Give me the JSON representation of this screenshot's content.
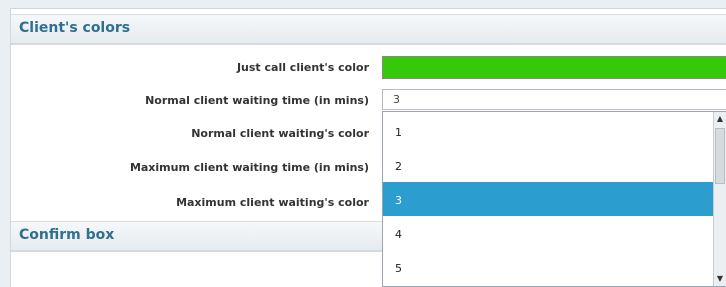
{
  "sections": {
    "clients_colors": {
      "title": "Client's colors"
    },
    "confirm_box": {
      "title": "Confirm box"
    }
  },
  "fields": {
    "just_call_color": {
      "label": "Just call client's color",
      "color": "#36c909"
    },
    "normal_wait_time": {
      "label": "Normal client waiting time (in mins)",
      "value": "3"
    },
    "normal_wait_color": {
      "label": "Normal client waiting's color"
    },
    "max_wait_time": {
      "label": "Maximum client waiting time (in mins)"
    },
    "max_wait_color": {
      "label": "Maximum client waiting's color"
    }
  },
  "dropdown": {
    "options": [
      "1",
      "2",
      "3",
      "4",
      "5"
    ],
    "selected": "3",
    "icons": {
      "up": "scroll-up-icon",
      "down": "scroll-down-icon"
    }
  }
}
